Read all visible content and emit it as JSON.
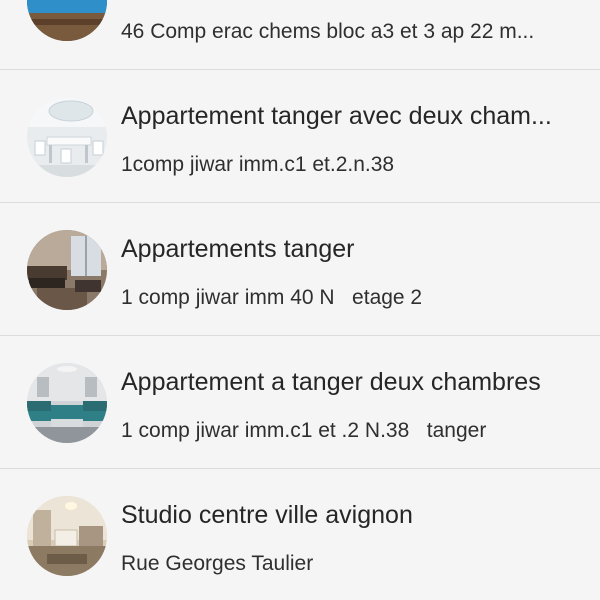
{
  "listings": [
    {
      "title": "",
      "subtitle": "46 Comp erac chems bloc a3 et 3 ap 22 m...",
      "image": "pool-photo"
    },
    {
      "title": "Appartement tanger avec deux cham...",
      "subtitle": "1comp jiwar imm.c1 et.2.n.38",
      "image": "white-dining-room-photo"
    },
    {
      "title": "Appartements tanger",
      "subtitle": "1 comp jiwar imm 40 N   etage 2",
      "image": "living-room-photo"
    },
    {
      "title": "Appartement a tanger deux chambres",
      "subtitle": "1 comp jiwar imm.c1 et .2 N.38   tanger",
      "image": "blue-sofa-photo"
    },
    {
      "title": "Studio centre ville avignon",
      "subtitle": "Rue Georges Taulier",
      "image": "studio-room-photo"
    }
  ]
}
